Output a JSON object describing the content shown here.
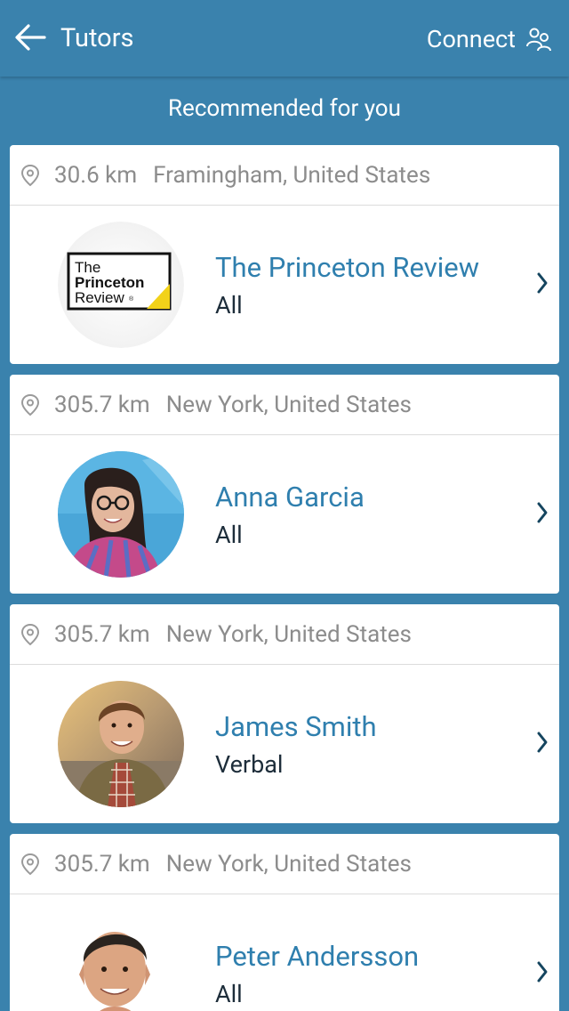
{
  "header": {
    "title": "Tutors",
    "connect_label": "Connect",
    "back_icon": "arrow-left-icon",
    "connect_icon": "people-connect-icon"
  },
  "subheader": "Recommended for you",
  "tutors": [
    {
      "distance": "30.6 km",
      "location": "Framingham, United States",
      "name": "The Princeton Review",
      "subject": "All",
      "logo": {
        "line1": "The",
        "line2": "Princeton",
        "line3": "Review",
        "mark": "®"
      }
    },
    {
      "distance": "305.7 km",
      "location": "New York, United States",
      "name": "Anna Garcia",
      "subject": "All"
    },
    {
      "distance": "305.7 km",
      "location": "New York, United States",
      "name": "James Smith",
      "subject": "Verbal"
    },
    {
      "distance": "305.7 km",
      "location": "New York, United States",
      "name": "Peter Andersson",
      "subject": "All"
    }
  ],
  "colors": {
    "primary": "#3a82ad",
    "name_text": "#2f7fae",
    "muted_text": "#8c8c8c",
    "subject_text": "#1d2d3a"
  }
}
